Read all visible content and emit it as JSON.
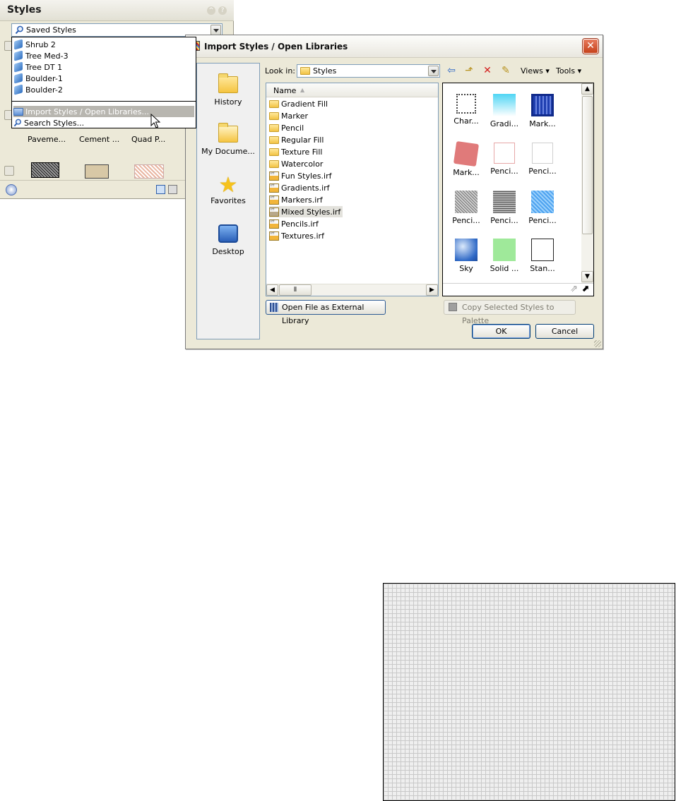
{
  "palette": {
    "title": "Styles",
    "saved_styles_value": "Saved Styles",
    "dropdown_items": [
      "Shrub 2",
      "Tree Med-3",
      "Tree DT 1",
      "Boulder-1",
      "Boulder-2"
    ],
    "import_item": "Import Styles / Open Libraries...",
    "search_item": "Search Styles...",
    "thumb_labels": [
      "Paveme...",
      "Cement ...",
      "Quad P..."
    ]
  },
  "dialog": {
    "title": "Import Styles / Open Libraries",
    "places": [
      "History",
      "My Docume...",
      "Favorites",
      "Desktop"
    ],
    "look_in_label": "Look in:",
    "look_in_value": "Styles",
    "views_label": "Views",
    "tools_label": "Tools",
    "name_column": "Name",
    "files": [
      {
        "name": "Gradient Fill",
        "type": "folder"
      },
      {
        "name": "Marker",
        "type": "folder"
      },
      {
        "name": "Pencil",
        "type": "folder"
      },
      {
        "name": "Regular Fill",
        "type": "folder"
      },
      {
        "name": "Texture Fill",
        "type": "folder"
      },
      {
        "name": "Watercolor",
        "type": "folder"
      },
      {
        "name": "Fun Styles.irf",
        "type": "irf"
      },
      {
        "name": "Gradients.irf",
        "type": "irf"
      },
      {
        "name": "Markers.irf",
        "type": "irf"
      },
      {
        "name": "Mixed Styles.irf",
        "type": "irf",
        "selected": true
      },
      {
        "name": "Pencils.irf",
        "type": "irf"
      },
      {
        "name": "Textures.irf",
        "type": "irf"
      }
    ],
    "previews": [
      "Char...",
      "Gradi...",
      "Mark...",
      "Mark...",
      "Penci...",
      "Penci...",
      "Penci...",
      "Penci...",
      "Penci...",
      "Sky",
      "Solid ...",
      "Stan..."
    ],
    "open_external_button": "Open File as External Library",
    "copy_button": "Copy Selected Styles to Palette",
    "ok_button": "OK",
    "cancel_button": "Cancel"
  }
}
